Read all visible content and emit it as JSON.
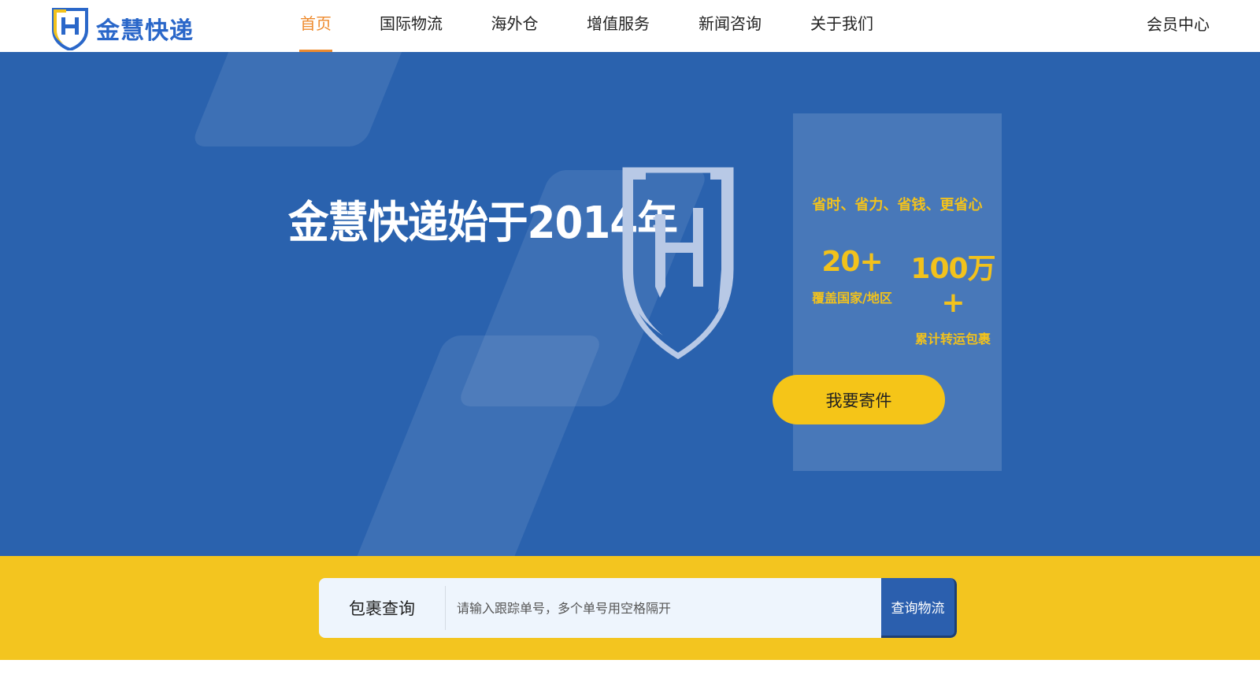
{
  "header": {
    "brand": "金慧快递",
    "logo_icon": "shield-h-logo",
    "nav": [
      {
        "label": "首页",
        "active": true
      },
      {
        "label": "国际物流",
        "active": false
      },
      {
        "label": "海外仓",
        "active": false
      },
      {
        "label": "增值服务",
        "active": false
      },
      {
        "label": "新闻咨询",
        "active": false
      },
      {
        "label": "关于我们",
        "active": false
      }
    ],
    "member_center": "会员中心"
  },
  "hero": {
    "title": "金慧快递始于2014年",
    "emblem_icon": "shield-h-emblem",
    "slogan": "省时、省力、省钱、更省心",
    "stats": [
      {
        "value": "20+",
        "label": "覆盖国家/地区"
      },
      {
        "value": "100万+",
        "label": "累计转运包裹"
      }
    ],
    "ship_button": "我要寄件"
  },
  "tracking": {
    "label": "包裹查询",
    "placeholder": "请输入跟踪单号，多个单号用空格隔开",
    "value": "",
    "button": "查询物流"
  },
  "colors": {
    "brand_blue": "#2a62ae",
    "accent_orange": "#ee8a2d",
    "accent_yellow": "#f3c51f",
    "stat_yellow": "#f2c21c"
  }
}
